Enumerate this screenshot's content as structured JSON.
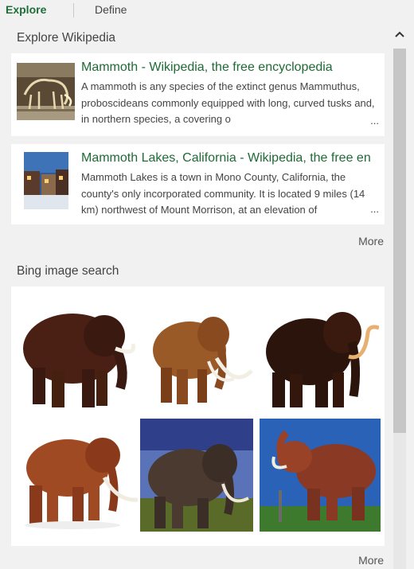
{
  "tabs": [
    {
      "label": "Explore",
      "active": true
    },
    {
      "label": "Define",
      "active": false
    }
  ],
  "wikipedia": {
    "section_title": "Explore Wikipedia",
    "results": [
      {
        "title": "Mammoth - Wikipedia, the free encyclopedia",
        "description": "A mammoth is any species of the extinct genus Mammuthus, proboscideans commonly equipped with long, curved tusks and, in northern species, a covering o",
        "thumbnail": "mammoth-skeleton-museum"
      },
      {
        "title": "Mammoth Lakes, California - Wikipedia, the free en",
        "description": "Mammoth Lakes is a town in Mono County, California, the county's only incorporated community. It is located 9 miles (14 km) northwest of Mount Morrison, at an elevation of",
        "thumbnail": "mammoth-lakes-town"
      }
    ],
    "ellipsis": "...",
    "more_label": "More"
  },
  "bing": {
    "section_title": "Bing image search",
    "images": [
      "woolly-mammoth-dark-brown",
      "mammoth-orange-brown-curled-tusks",
      "woolly-mammoth-black-long-tusks",
      "mammoth-reddish-brown-walking",
      "mammoth-on-grass-blue-sky",
      "mammoth-statue-blue-sky"
    ],
    "more_label": "More"
  },
  "scrollbar": {
    "up_icon": "chevron-up-icon",
    "position": 0
  },
  "colors": {
    "accent": "#1e6e3a",
    "title_link": "#1e6b35",
    "background": "#f1f1f1",
    "card": "#ffffff"
  }
}
